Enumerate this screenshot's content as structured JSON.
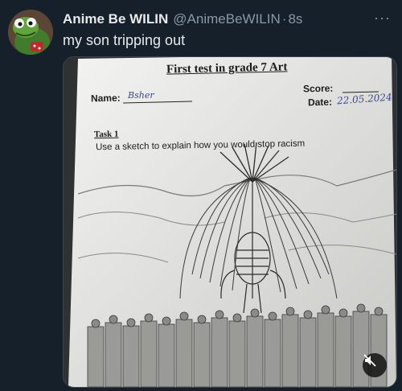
{
  "tweet": {
    "display_name": "Anime Be WILIN",
    "handle": "@AnimeBeWILIN",
    "separator": "·",
    "timestamp": "8s",
    "text": "my son tripping out",
    "more_icon": "more-icon"
  },
  "sheet": {
    "title": "First test in grade 7 Art",
    "name_label": "Name:",
    "name_value": "Bsher",
    "score_label": "Score:",
    "date_label": "Date:",
    "date_value": "22.05.2024",
    "task_label": "Task 1",
    "task_text": "Use a sketch to explain how you would stop racism"
  },
  "media": {
    "mute_icon": "muted-speaker-icon"
  },
  "colors": {
    "background": "#15202b",
    "text_primary": "#e7e9ea",
    "text_secondary": "#8b98a5"
  }
}
